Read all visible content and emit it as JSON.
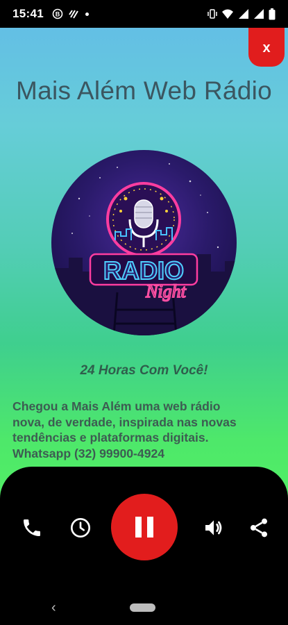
{
  "status_bar": {
    "time": "15:41"
  },
  "header": {
    "close_label": "x",
    "title": "Mais Além Web Rádio"
  },
  "logo": {
    "line1": "RADIO",
    "line2": "Night"
  },
  "tagline": "24 Horas Com Você!",
  "description": {
    "lines": [
      "Chegou a Mais Além uma web rádio",
      "nova, de verdade, inspirada nas novas",
      "tendências e plataformas digitais.",
      "Whatsapp (32) 99900-4924"
    ]
  },
  "player": {
    "controls": [
      "phone-icon",
      "clock-icon",
      "pause-icon",
      "volume-icon",
      "share-icon"
    ]
  },
  "colors": {
    "accent_red": "#e21d1d",
    "title_text": "#3b5660",
    "bar_bg": "#000000"
  }
}
